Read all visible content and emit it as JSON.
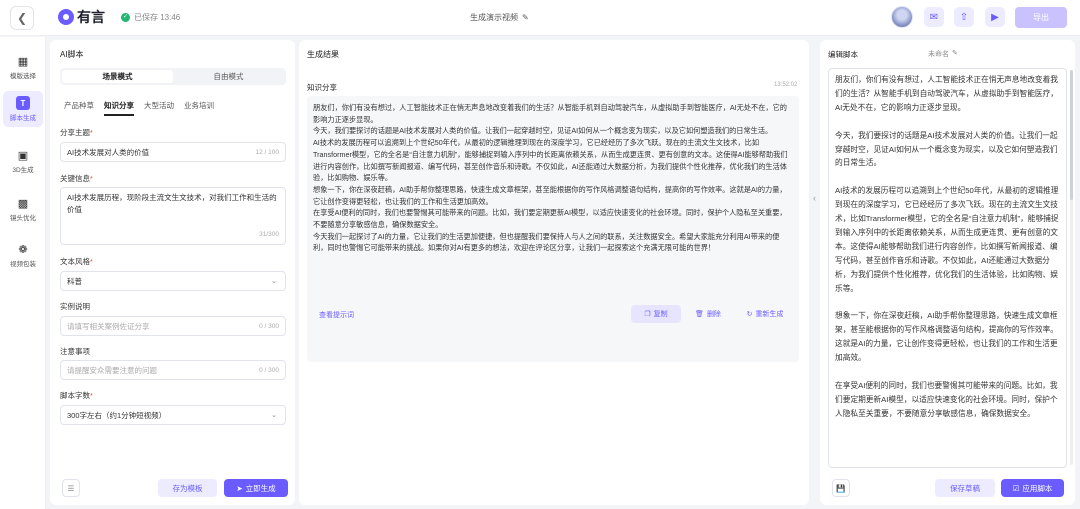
{
  "header": {
    "logo_text": "有言",
    "saved_status": "已保存 13:46",
    "doc_title": "生成演示视频",
    "export_label": "导出",
    "icons": [
      "mail-icon",
      "share-icon",
      "video-icon"
    ]
  },
  "sidebar": {
    "items": [
      {
        "label": "模版选择",
        "icon": "grid-icon"
      },
      {
        "label": "脚本生成",
        "icon": "text-icon"
      },
      {
        "label": "3D生成",
        "icon": "monitor-icon"
      },
      {
        "label": "镜头优化",
        "icon": "camera-icon"
      },
      {
        "label": "视频包装",
        "icon": "film-icon"
      }
    ]
  },
  "left": {
    "title": "AI脚本",
    "modes": [
      "场景模式",
      "自由模式"
    ],
    "sub_tabs": [
      "产品种草",
      "知识分享",
      "大型活动",
      "业务培训"
    ],
    "topic_label": "分享主题",
    "topic_value": "AI技术发展对人类的价值",
    "topic_count": "12 / 100",
    "keywords_label": "关键信息",
    "keywords_value": "AI技术发展历程，现阶段主流文生文技术，对我们工作和生活的价值",
    "keywords_count": "31/300",
    "style_label": "文本风格",
    "style_value": "科普",
    "example_label": "实例说明",
    "example_placeholder": "请填写相关案例佐证分享",
    "example_count": "0 / 300",
    "notes_label": "注意事项",
    "notes_placeholder": "请提醒安众需要注意的问题",
    "notes_count": "0 / 300",
    "wordcount_label": "脚本字数",
    "wordcount_value": "300字左右（约1分钟短视频）",
    "save_template_label": "存为模板",
    "generate_label": "立即生成"
  },
  "middle": {
    "title": "生成结果",
    "card_title": "知识分享",
    "card_time": "13:52:02",
    "paragraphs": [
      "朋友们，你们有没有想过，人工智能技术正在悄无声息地改变着我们的生活？从智能手机到自动驾驶汽车，从虚拟助手到智能医疗，AI无处不在，它的影响力正逐步显现。",
      "今天，我们要探讨的话题是AI技术发展对人类的价值。让我们一起穿越时空，见证AI如何从一个概念变为现实，以及它如何塑造我们的日常生活。",
      "AI技术的发展历程可以追溯到上个世纪50年代，从最初的逻辑推理到现在的深度学习，它已经经历了多次飞跃。现在的主流文生文技术，比如Transformer模型，它的全名是“自注意力机制”，能够捕捉到输入序列中的长距离依赖关系，从而生成更连贯、更有创意的文本。这使得AI能够帮助我们进行内容创作，比如撰写新闻报道、编写代码，甚至创作音乐和诗歌。不仅如此，AI还能通过大数据分析，为我们提供个性化推荐，优化我们的生活体验，比如购物、娱乐等。",
      "想象一下，你在深夜赶稿，AI助手帮你整理思路，快速生成文章框架，甚至能根据你的写作风格调整语句结构，提高你的写作效率。这就是AI的力量，它让创作变得更轻松，也让我们的工作和生活更加高效。",
      "在享受AI便利的同时，我们也要警惕其可能带来的问题。比如，我们要定期更新AI模型，以适应快速变化的社会环境。同时，保护个人隐私至关重要，不要随意分享敏感信息，确保数据安全。",
      "今天我们一起探讨了AI的力量，它让我们的生活更加便捷，但也提醒我们要保持人与人之间的联系，关注数据安全。希望大家能充分利用AI带来的便利，同时也警惕它可能带来的挑战。如果你对AI有更多的想法，欢迎在评论区分享，让我们一起探索这个充满无限可能的世界！"
    ],
    "view_prompt_label": "查看提示词",
    "copy_label": "复制",
    "delete_label": "删除",
    "regenerate_label": "重新生成"
  },
  "right": {
    "title": "编辑脚本",
    "name": "未命名",
    "paragraphs": [
      "朋友们，你们有没有想过，人工智能技术正在悄无声息地改变着我们的生活？从智能手机到自动驾驶汽车，从虚拟助手到智能医疗，AI无处不在，它的影响力正逐步显现。",
      "今天，我们要探讨的话题是AI技术发展对人类的价值。让我们一起穿越时空，见证AI如何从一个概念变为现实，以及它如何塑造我们的日常生活。",
      "AI技术的发展历程可以追溯到上个世纪50年代，从最初的逻辑推理到现在的深度学习，它已经经历了多次飞跃。现在的主流文生文技术，比如Transformer模型，它的全名是“自注意力机制”，能够捕捉到输入序列中的长距离依赖关系，从而生成更连贯、更有创意的文本。这使得AI能够帮助我们进行内容创作，比如撰写新闻报道、编写代码，甚至创作音乐和诗歌。不仅如此，AI还能通过大数据分析，为我们提供个性化推荐，优化我们的生活体验，比如购物、娱乐等。",
      "想象一下，你在深夜赶稿，AI助手帮你整理思路，快速生成文章框架，甚至能根据你的写作风格调整语句结构，提高你的写作效率。这就是AI的力量，它让创作变得更轻松，也让我们的工作和生活更加高效。",
      "在享受AI便利的同时，我们也要警惕其可能带来的问题。比如，我们要定期更新AI模型，以适应快速变化的社会环境。同时，保护个人隐私至关重要，不要随意分享敏感信息，确保数据安全。"
    ],
    "save_draft_label": "保存草稿",
    "apply_label": "应用脚本"
  },
  "colors": {
    "accent": "#6a5cff",
    "accent_light": "#ecebff",
    "required": "#e2423b",
    "saved": "#22b573"
  }
}
